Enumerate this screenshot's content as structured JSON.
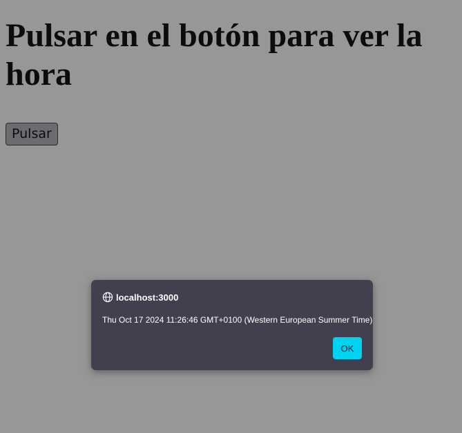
{
  "page": {
    "heading": "Pulsar en el botón para ver la hora",
    "button_label": "Pulsar"
  },
  "dialog": {
    "origin": "localhost:3000",
    "origin_icon": "globe-icon",
    "message": "Thu Oct 17 2024 11:26:46 GMT+0100 (Western European Summer Time)",
    "ok_label": "OK"
  },
  "colors": {
    "backdrop": "#979798",
    "dialog_background": "#42404e",
    "ok_button": "#00d3f2"
  }
}
